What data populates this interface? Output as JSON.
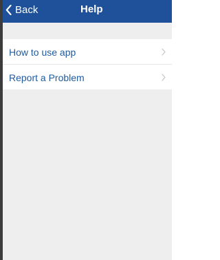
{
  "navbar": {
    "back_label": "Back",
    "title": "Help",
    "back_icon": "chevron-left-icon",
    "background_color": "#1e5199"
  },
  "menu": {
    "items": [
      {
        "label": "How to use app",
        "icon": "chevron-right-icon"
      },
      {
        "label": "Report a Problem",
        "icon": "chevron-right-icon"
      }
    ],
    "label_color": "#1f5a9c"
  }
}
